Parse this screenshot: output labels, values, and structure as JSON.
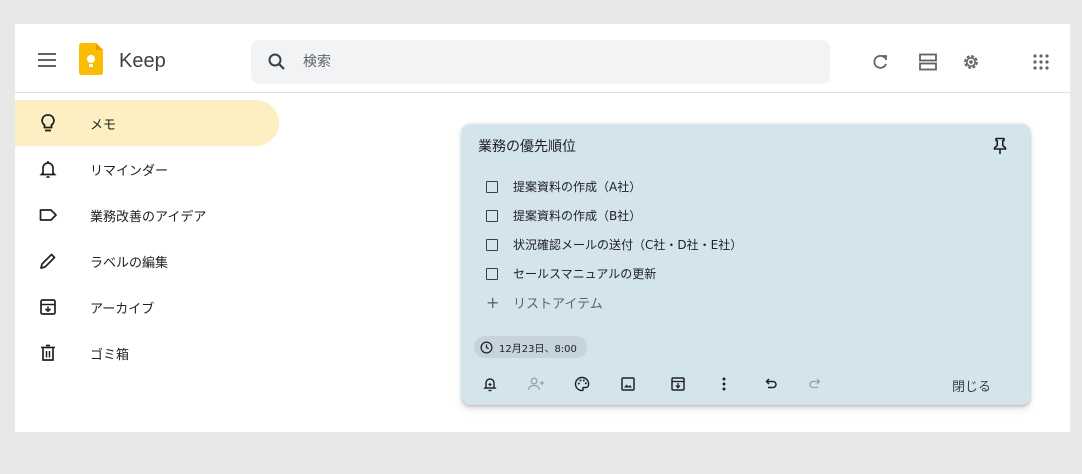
{
  "header": {
    "app_name": "Keep",
    "search": {
      "placeholder": "検索"
    }
  },
  "sidebar": {
    "items": [
      {
        "label": "メモ",
        "icon": "lightbulb-icon",
        "active": true
      },
      {
        "label": "リマインダー",
        "icon": "bell-icon"
      },
      {
        "label": "業務改善のアイデア",
        "icon": "label-icon"
      },
      {
        "label": "ラベルの編集",
        "icon": "pencil-icon"
      },
      {
        "label": "アーカイブ",
        "icon": "archive-icon"
      },
      {
        "label": "ゴミ箱",
        "icon": "trash-icon"
      }
    ]
  },
  "note": {
    "title": "業務の優先順位",
    "checklist": [
      "提案資料の作成（A社）",
      "提案資料の作成（B社）",
      "状況確認メールの送付（C社・D社・E社）",
      "セールスマニュアルの更新"
    ],
    "add_item_label": "リストアイテム",
    "reminder": "12月23日、8:00",
    "close_label": "閉じる"
  },
  "colors": {
    "note_background": "#d4e4ed",
    "active_nav": "#feefc3",
    "logo_yellow": "#fbbc04"
  }
}
